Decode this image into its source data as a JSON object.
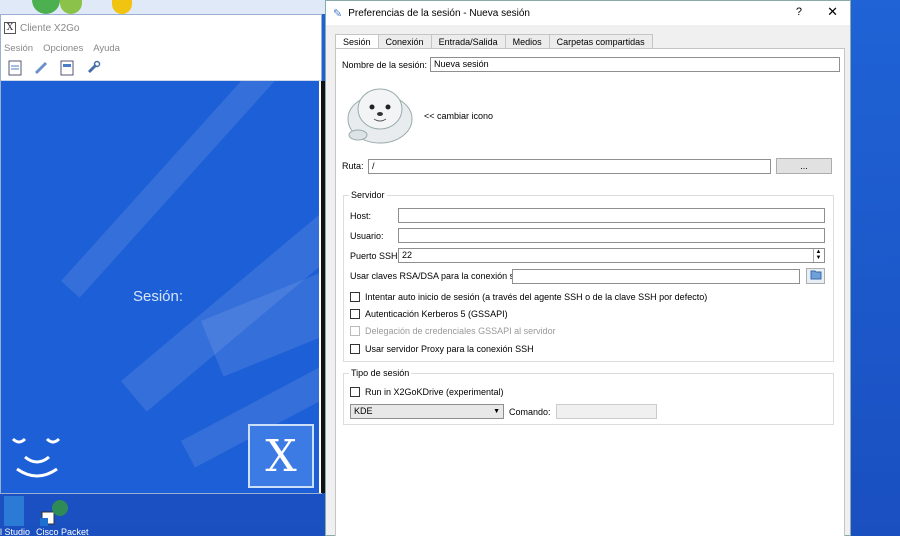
{
  "desktop": {
    "bottom_labels": [
      "l Studio",
      "Cisco Packet"
    ]
  },
  "client": {
    "title": "Cliente X2Go",
    "app_icon": "X",
    "menu": [
      "Sesión",
      "Opciones",
      "Ayuda"
    ],
    "canvas_label": "Sesión:",
    "logo_text": "X"
  },
  "dialog": {
    "title": "Preferencias de la sesión - Nueva sesión",
    "help": "?",
    "close": "✕",
    "tabs": [
      "Sesión",
      "Conexión",
      "Entrada/Salida",
      "Medios",
      "Carpetas compartidas"
    ],
    "active_tab": "Sesión",
    "session_name_label": "Nombre de la sesión:",
    "session_name_value": "Nueva sesión",
    "change_icon_label": "<< cambiar icono",
    "route_label": "Ruta:",
    "route_value": "/",
    "browse_label": "...",
    "server": {
      "title": "Servidor",
      "host_label": "Host:",
      "host_value": "",
      "user_label": "Usuario:",
      "user_value": "",
      "ssh_port_label": "Puerto SSH:",
      "ssh_port_value": "22",
      "rsa_label": "Usar claves RSA/DSA para la conexión ssh:",
      "rsa_value": "",
      "checks": [
        {
          "label": "Intentar auto inicio de sesión (a través del agente SSH o de la clave SSH por defecto)",
          "checked": false,
          "enabled": true
        },
        {
          "label": "Autenticación Kerberos 5 (GSSAPI)",
          "checked": false,
          "enabled": true
        },
        {
          "label": "Delegación de credenciales GSSAPI al servidor",
          "checked": false,
          "enabled": false
        },
        {
          "label": "Usar servidor Proxy para la conexión SSH",
          "checked": false,
          "enabled": true
        }
      ]
    },
    "session_type": {
      "title": "Tipo de sesión",
      "run_label": "Run in X2GoKDrive (experimental)",
      "desktop_value": "KDE",
      "command_label": "Comando:",
      "command_value": ""
    }
  }
}
